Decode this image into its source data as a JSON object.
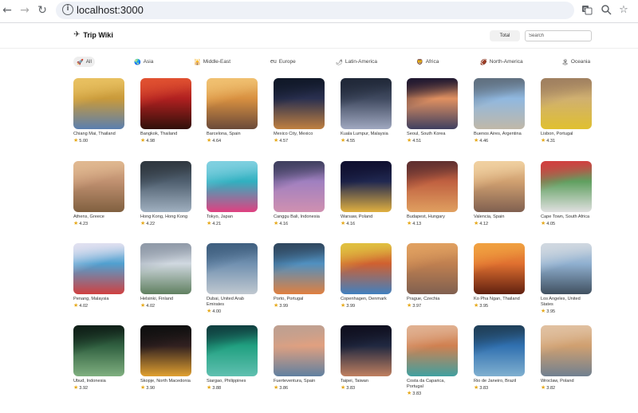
{
  "browser": {
    "url": "localhost:3000"
  },
  "header": {
    "title": "Trip Wiki",
    "total_label": "Total",
    "search_placeholder": "Search"
  },
  "regions": [
    {
      "icon": "🚀",
      "label": "All",
      "active": true
    },
    {
      "icon": "🌏",
      "label": "Asia",
      "active": false
    },
    {
      "icon": "🕌",
      "label": "Middle-East",
      "active": false
    },
    {
      "icon": "eu",
      "label": "Europe",
      "active": false
    },
    {
      "icon": "🌶",
      "label": "Latin-America",
      "active": false
    },
    {
      "icon": "🦁",
      "label": "Africa",
      "active": false
    },
    {
      "icon": "🏈",
      "label": "North-America",
      "active": false
    },
    {
      "icon": "🏝",
      "label": "Oceania",
      "active": false
    }
  ],
  "cities": [
    {
      "name": "Chiang Mai, Thailand",
      "rating": "5.00",
      "colors": [
        "#c99a3a",
        "#5a7fb0",
        "#e8c060"
      ]
    },
    {
      "name": "Bangkok, Thailand",
      "rating": "4.98",
      "colors": [
        "#b02020",
        "#30100a",
        "#e05030"
      ]
    },
    {
      "name": "Barcelona, Spain",
      "rating": "4.64",
      "colors": [
        "#d89040",
        "#6a4a3a",
        "#f0c070"
      ]
    },
    {
      "name": "Mexico City, Mexico",
      "rating": "4.57",
      "colors": [
        "#2a3050",
        "#c08040",
        "#101828"
      ]
    },
    {
      "name": "Kuala Lumpur, Malaysia",
      "rating": "4.55",
      "colors": [
        "#404a60",
        "#a0a8c0",
        "#202838"
      ]
    },
    {
      "name": "Seoul, South Korea",
      "rating": "4.51",
      "colors": [
        "#e09060",
        "#404060",
        "#201830"
      ]
    },
    {
      "name": "Buenos Aires, Argentina",
      "rating": "4.46",
      "colors": [
        "#90b8e0",
        "#c0b8a8",
        "#607080"
      ]
    },
    {
      "name": "Lisbon, Portugal",
      "rating": "4.31",
      "colors": [
        "#d0b070",
        "#e0c030",
        "#a08060"
      ]
    },
    {
      "name": "Athens, Greece",
      "rating": "4.23",
      "colors": [
        "#c09070",
        "#806040",
        "#e0b890"
      ]
    },
    {
      "name": "Hong Kong, Hong Kong",
      "rating": "4.22",
      "colors": [
        "#506070",
        "#a0b0c0",
        "#303840"
      ]
    },
    {
      "name": "Tokyo, Japan",
      "rating": "4.21",
      "colors": [
        "#30b0c0",
        "#e04080",
        "#80d0e0"
      ]
    },
    {
      "name": "Canggu Bali, Indonesia",
      "rating": "4.16",
      "colors": [
        "#a080c0",
        "#d090b0",
        "#404060"
      ]
    },
    {
      "name": "Warsaw, Poland",
      "rating": "4.16",
      "colors": [
        "#202850",
        "#e0b040",
        "#101030"
      ]
    },
    {
      "name": "Budapest, Hungary",
      "rating": "4.13",
      "colors": [
        "#c06040",
        "#e0a060",
        "#603030"
      ]
    },
    {
      "name": "Valencia, Spain",
      "rating": "4.12",
      "colors": [
        "#d0a070",
        "#806050",
        "#f0d0a0"
      ]
    },
    {
      "name": "Cape Town, South Africa",
      "rating": "4.05",
      "colors": [
        "#60a060",
        "#e0e0e0",
        "#d04040"
      ]
    },
    {
      "name": "Penang, Malaysia",
      "rating": "4.02",
      "colors": [
        "#50a0d0",
        "#d04040",
        "#e0e0f0"
      ]
    },
    {
      "name": "Helsinki, Finland",
      "rating": "4.02",
      "colors": [
        "#d0d8e0",
        "#608060",
        "#909aa8"
      ]
    },
    {
      "name": "Dubai, United Arab Emirates",
      "rating": "4.00",
      "colors": [
        "#7090b0",
        "#c0c8d0",
        "#406080"
      ]
    },
    {
      "name": "Porto, Portugal",
      "rating": "3.99",
      "colors": [
        "#5090c0",
        "#e08040",
        "#304860"
      ]
    },
    {
      "name": "Copenhagen, Denmark",
      "rating": "3.99",
      "colors": [
        "#d06030",
        "#4080c0",
        "#e0c040"
      ]
    },
    {
      "name": "Prague, Czechia",
      "rating": "3.97",
      "colors": [
        "#c08050",
        "#806050",
        "#e0a060"
      ]
    },
    {
      "name": "Ko Pha Ngan, Thailand",
      "rating": "3.95",
      "colors": [
        "#e07030",
        "#602010",
        "#f0a040"
      ]
    },
    {
      "name": "Los Angeles, United States",
      "rating": "3.95",
      "colors": [
        "#90b0d0",
        "#405060",
        "#d0d8e0"
      ]
    },
    {
      "name": "Ubud, Indonesia",
      "rating": "3.92",
      "colors": [
        "#306040",
        "#80b080",
        "#102018"
      ]
    },
    {
      "name": "Skopje, North Macedonia",
      "rating": "3.90",
      "colors": [
        "#302020",
        "#e0a030",
        "#101010"
      ]
    },
    {
      "name": "Siargao, Philippines",
      "rating": "3.88",
      "colors": [
        "#20a080",
        "#60c0b0",
        "#104040"
      ]
    },
    {
      "name": "Fuerteventura, Spain",
      "rating": "3.86",
      "colors": [
        "#e0a080",
        "#6080a0",
        "#c0a090"
      ]
    },
    {
      "name": "Taipei, Taiwan",
      "rating": "3.83",
      "colors": [
        "#202840",
        "#c08060",
        "#101020"
      ]
    },
    {
      "name": "Costa da Caparica, Portugal",
      "rating": "3.83",
      "colors": [
        "#d08050",
        "#40a0a0",
        "#e0b090"
      ]
    },
    {
      "name": "Rio de Janeiro, Brazil",
      "rating": "3.83",
      "colors": [
        "#3070b0",
        "#80b0d0",
        "#20405a"
      ]
    },
    {
      "name": "Wroclaw, Poland",
      "rating": "3.82",
      "colors": [
        "#d0a070",
        "#708090",
        "#e0c0a0"
      ]
    }
  ]
}
